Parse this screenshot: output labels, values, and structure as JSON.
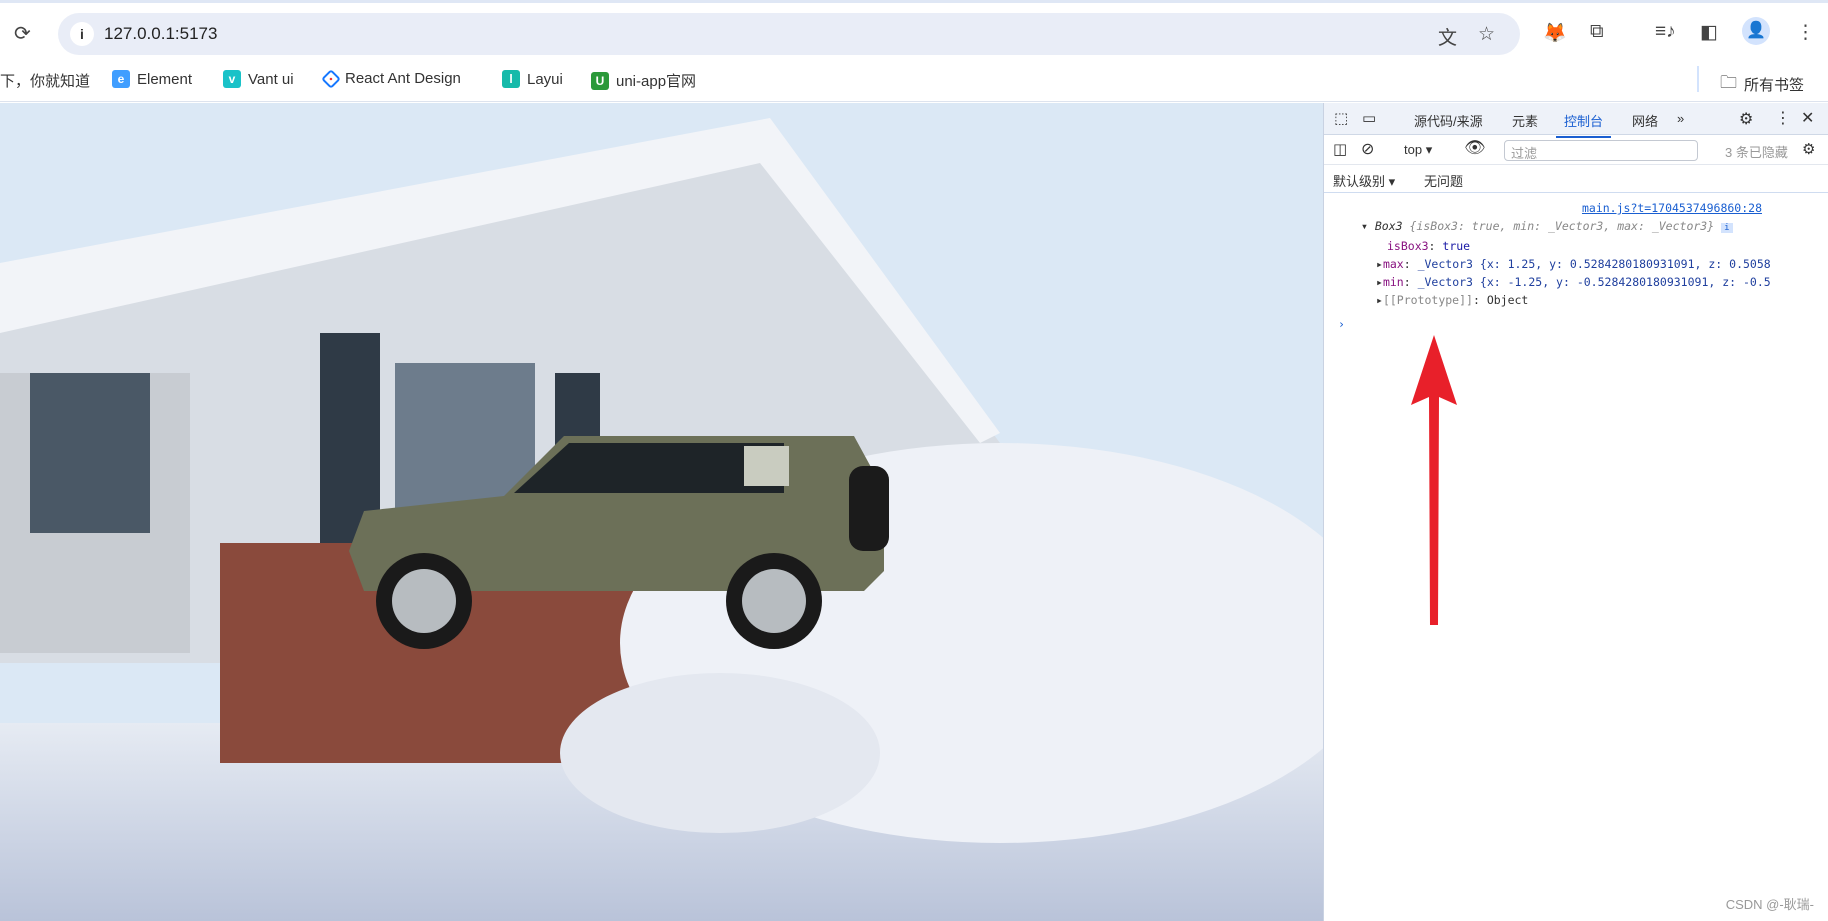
{
  "browser": {
    "url": "127.0.0.1:5173",
    "bookmarks": [
      {
        "label": "下，你就知道",
        "icon": "none"
      },
      {
        "label": "Element",
        "icon": "element-logo",
        "color": "#409eff"
      },
      {
        "label": "Vant ui",
        "icon": "vant-logo",
        "color": "#1ac2c8"
      },
      {
        "label": "React Ant Design",
        "icon": "antd-logo",
        "color": "#1677ff"
      },
      {
        "label": "Layui",
        "icon": "layui-logo",
        "color": "#16baaa"
      },
      {
        "label": "uni-app官网",
        "icon": "uniapp-logo",
        "color": "#2b9939"
      }
    ],
    "all_bookmarks": "所有书签"
  },
  "devtools": {
    "tabs": [
      "源代码/来源",
      "元素",
      "控制台",
      "网络"
    ],
    "active_tab": "控制台",
    "context": "top",
    "filter_placeholder": "过滤",
    "hidden_count": "3 条已隐藏",
    "level": "默认级别",
    "issues": "无问题",
    "console": {
      "source": "main.js?t=1704537496860:28",
      "summary_name": "Box3",
      "summary_body": "{isBox3: true, min: _Vector3, max: _Vector3}",
      "props": [
        {
          "key": "isBox3",
          "value": "true"
        },
        {
          "key": "max",
          "value": "_Vector3 {x: 1.25, y: 0.5284280180931091, z: 0.5058"
        },
        {
          "key": "min",
          "value": "_Vector3 {x: -1.25, y: -0.5284280180931091, z: -0.5"
        },
        {
          "key": "[[Prototype]]",
          "value": "Object"
        }
      ]
    }
  },
  "annotation": {
    "arrow_color": "#e8202a"
  },
  "watermark": "CSDN @-耿瑞-"
}
